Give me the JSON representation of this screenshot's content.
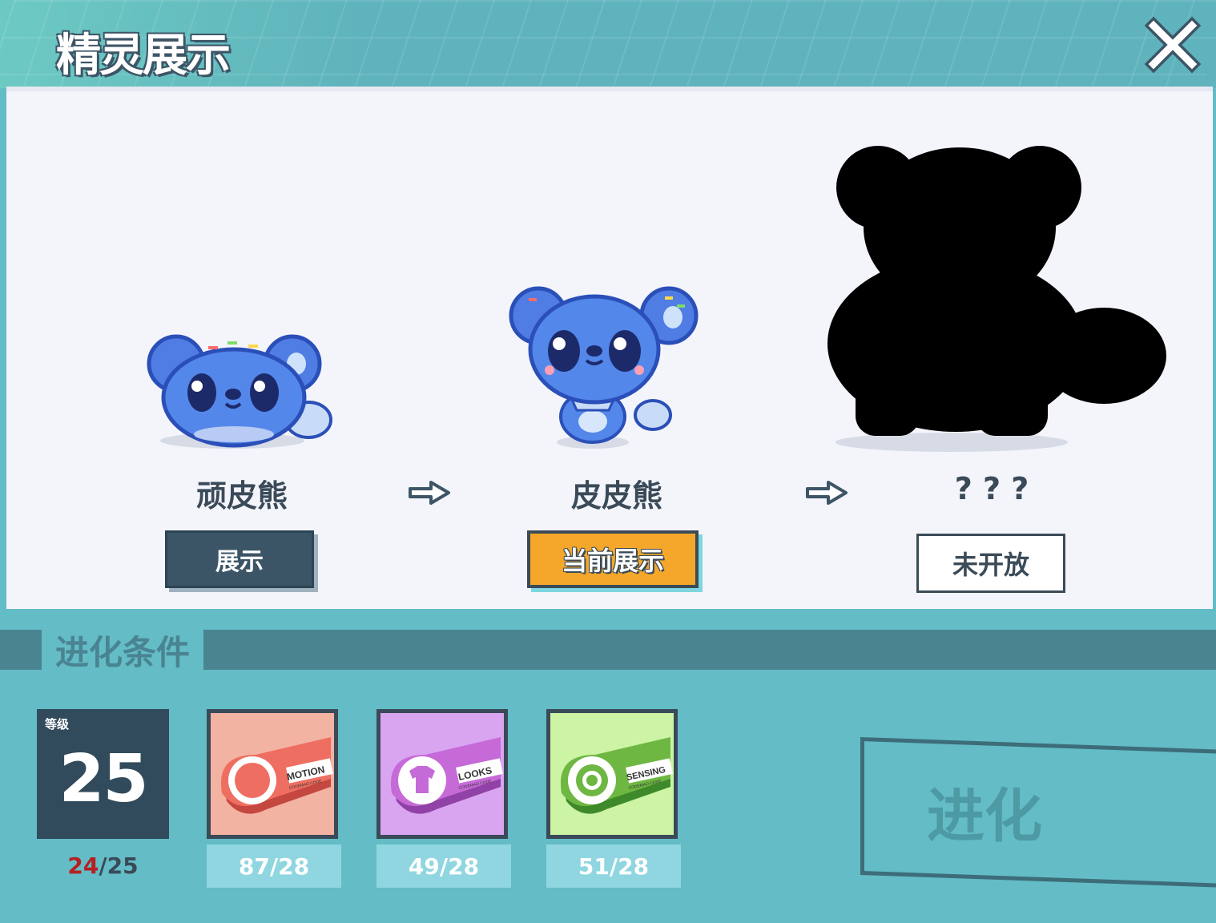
{
  "header": {
    "title": "精灵展示"
  },
  "stages": [
    {
      "name": "顽皮熊",
      "button": "展示"
    },
    {
      "name": "皮皮熊",
      "button": "当前展示"
    },
    {
      "name": "? ? ?",
      "button": "未开放"
    }
  ],
  "conditions": {
    "label": "进化条件",
    "level": {
      "tag": "等级",
      "value": "25",
      "current": "24",
      "total": "/25"
    },
    "cards": [
      {
        "card_text": "MOTION",
        "sub_text": "CODEMAO CODE",
        "icon": "ghost-icon",
        "count": "87/28",
        "color": "#ef6e62",
        "bg": "#f3b3a2"
      },
      {
        "card_text": "LOOKS",
        "sub_text": "CODEMAO CODE",
        "icon": "tshirt-icon",
        "count": "49/28",
        "color": "#c66ad8",
        "bg": "#d9a5f1"
      },
      {
        "card_text": "SENSING",
        "sub_text": "CODEMAO CODE",
        "icon": "target-icon",
        "count": "51/28",
        "color": "#6db742",
        "bg": "#cdf3a5"
      }
    ]
  },
  "evolve_button": "进化"
}
